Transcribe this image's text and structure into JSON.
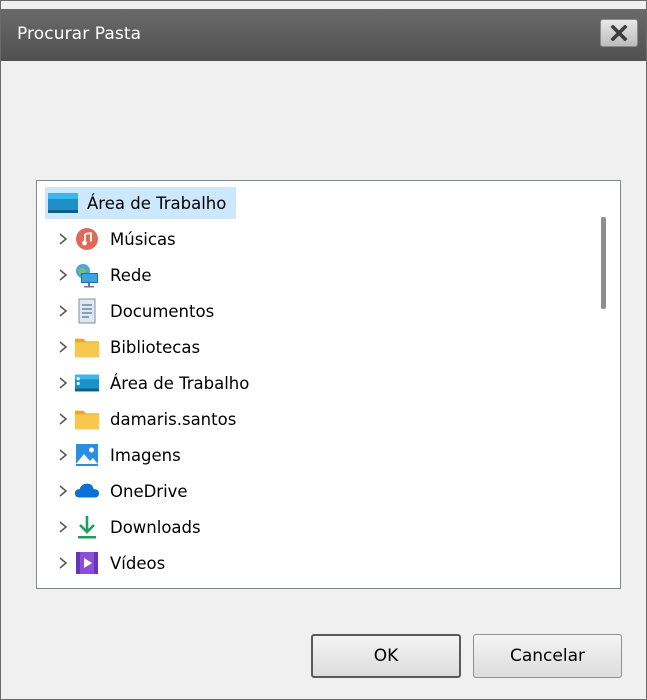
{
  "window": {
    "title": "Procurar Pasta",
    "close_label": "Fechar"
  },
  "tree": {
    "root": {
      "label": "Área de Trabalho",
      "icon": "desktop-icon",
      "selected": true
    },
    "items": [
      {
        "label": "Músicas",
        "icon": "music-icon"
      },
      {
        "label": "Rede",
        "icon": "network-icon"
      },
      {
        "label": "Documentos",
        "icon": "document-icon"
      },
      {
        "label": "Bibliotecas",
        "icon": "folder-icon"
      },
      {
        "label": "Área de Trabalho",
        "icon": "desktop-icon"
      },
      {
        "label": "damaris.santos",
        "icon": "folder-icon"
      },
      {
        "label": "Imagens",
        "icon": "pictures-icon"
      },
      {
        "label": "OneDrive",
        "icon": "cloud-icon"
      },
      {
        "label": "Downloads",
        "icon": "download-icon"
      },
      {
        "label": "Vídeos",
        "icon": "video-icon"
      }
    ]
  },
  "buttons": {
    "ok": "OK",
    "cancel": "Cancelar"
  },
  "colors": {
    "titlebar": "#585858",
    "selection": "#cce8ff",
    "dialog_bg": "#f0f0f0"
  }
}
